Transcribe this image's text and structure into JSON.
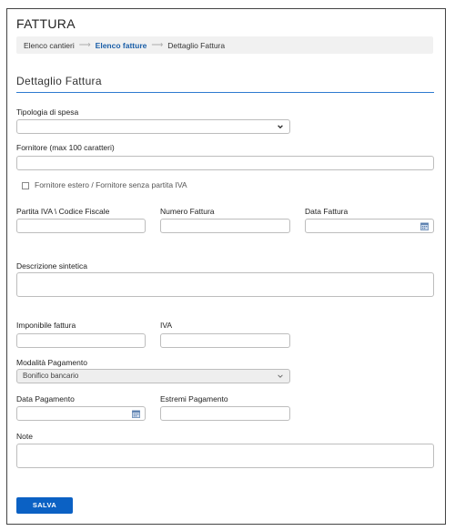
{
  "header": {
    "title": "FATTURA"
  },
  "breadcrumb": {
    "items": [
      {
        "label": "Elenco cantieri"
      },
      {
        "label": "Elenco fatture"
      },
      {
        "label": "Dettaglio Fattura"
      }
    ]
  },
  "form": {
    "section_title": "Dettaglio Fattura",
    "tipologia_label": "Tipologia di spesa",
    "tipologia_value": "",
    "fornitore_label": "Fornitore (max 100 caratteri)",
    "fornitore_value": "",
    "estero_label": "Fornitore estero / Fornitore senza partita IVA",
    "piva_label": "Partita IVA \\ Codice Fiscale",
    "numero_label": "Numero Fattura",
    "data_label": "Data Fattura",
    "descrizione_label": "Descrizione sintetica",
    "imponibile_label": "Imponibile fattura",
    "iva_label": "IVA",
    "modalita_label": "Modalità Pagamento",
    "modalita_value": "Bonifico bancario",
    "data_pagamento_label": "Data Pagamento",
    "estremi_label": "Estremi Pagamento",
    "note_label": "Note"
  },
  "actions": {
    "save_label": "SALVA"
  },
  "colors": {
    "accent": "#0b61c4",
    "link": "#1b5fa8",
    "rule": "#2e7bd0"
  }
}
